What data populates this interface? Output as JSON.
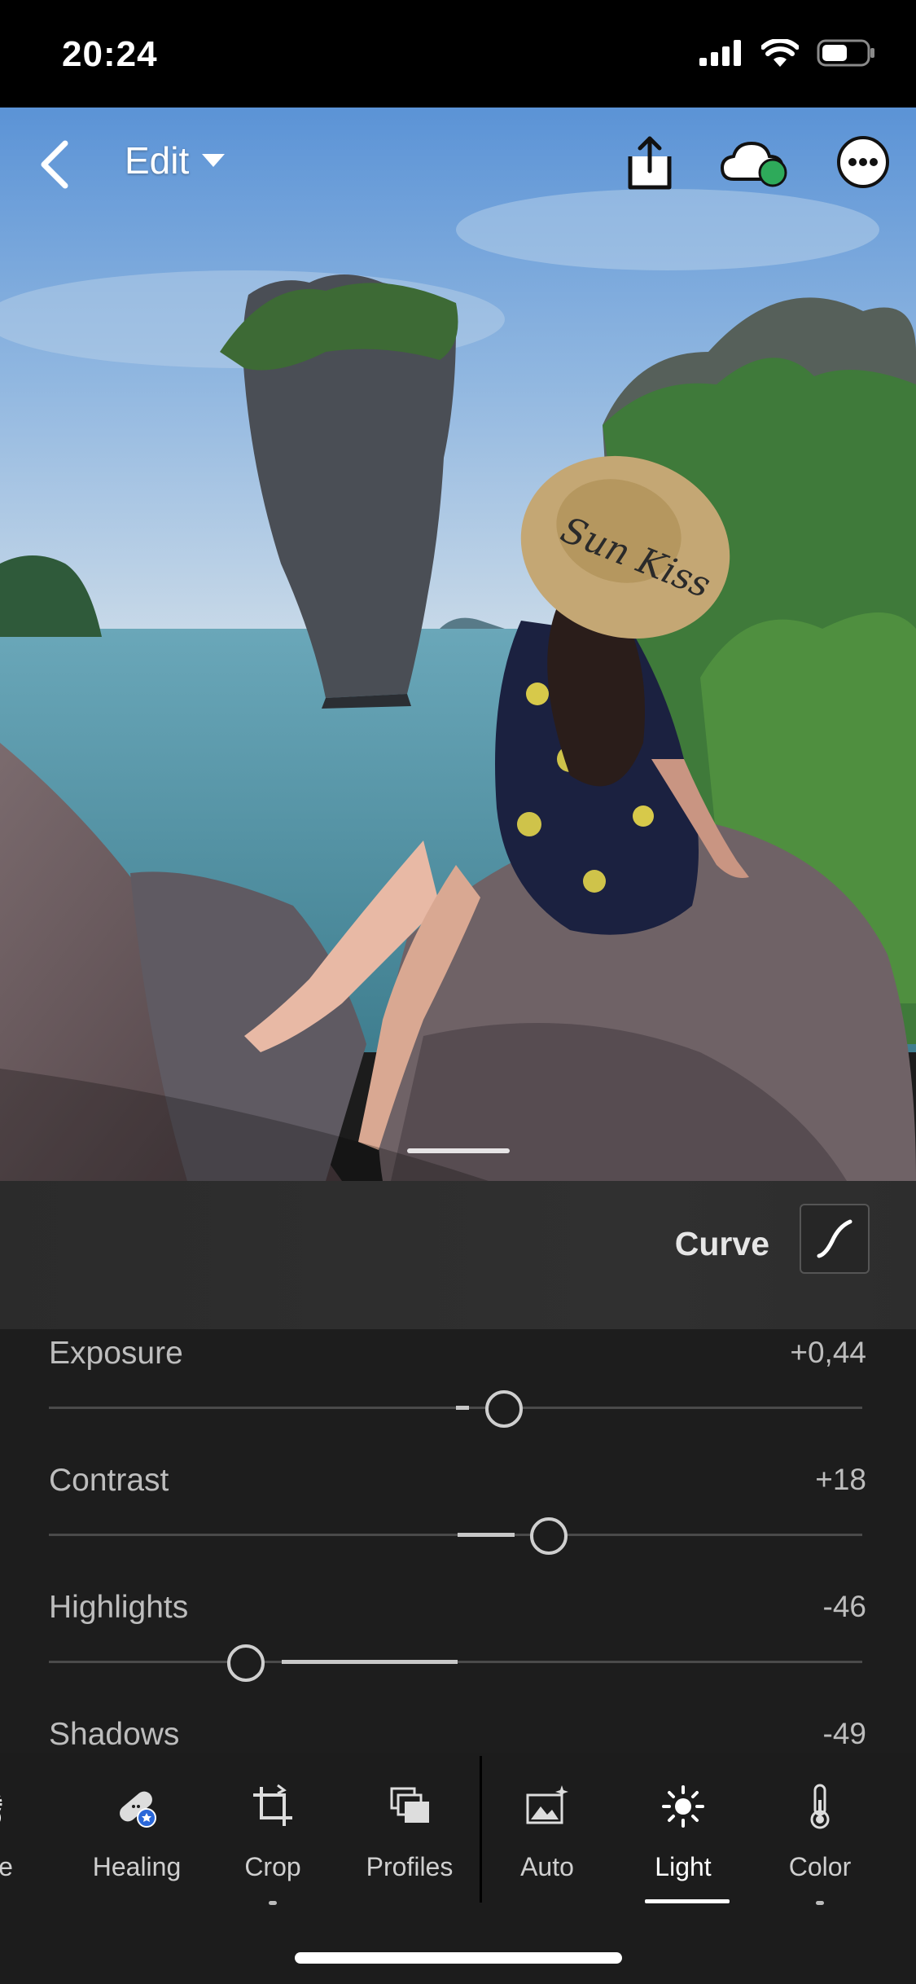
{
  "status": {
    "time": "20:24"
  },
  "header": {
    "edit_label": "Edit"
  },
  "curve": {
    "label": "Curve"
  },
  "sliders": [
    {
      "name": "Exposure",
      "value": "+0,44",
      "position": 0.561
    },
    {
      "name": "Contrast",
      "value": "+18",
      "position": 0.615
    },
    {
      "name": "Highlights",
      "value": "-46",
      "position": 0.242
    },
    {
      "name": "Shadows",
      "value": "-49",
      "position": 0.235
    }
  ],
  "tools": [
    {
      "label": "ctive",
      "icon": "selective-icon"
    },
    {
      "label": "Healing",
      "icon": "healing-bandage-icon"
    },
    {
      "label": "Crop",
      "icon": "crop-icon"
    },
    {
      "label": "Profiles",
      "icon": "profiles-icon"
    },
    {
      "label": "Auto",
      "icon": "auto-icon"
    },
    {
      "label": "Light",
      "icon": "sun-icon"
    },
    {
      "label": "Color",
      "icon": "thermometer-icon"
    }
  ],
  "active_tool": "Light",
  "colors": {
    "accent_badge": "#2a67d8",
    "cloud_sync": "#2eaa5a"
  }
}
